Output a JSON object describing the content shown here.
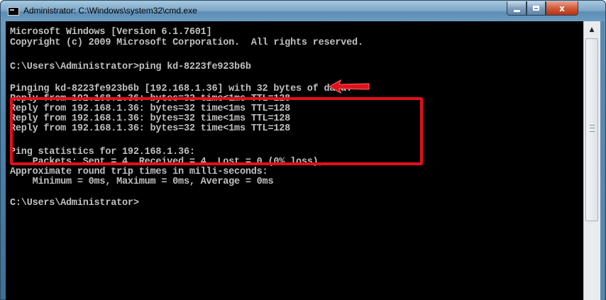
{
  "window": {
    "title": "Administrator: C:\\Windows\\system32\\cmd.exe",
    "icon": "cmd-icon",
    "controls": {
      "minimize": "minimize-icon",
      "maximize": "maximize-icon",
      "close_label": "x"
    }
  },
  "console": {
    "lines": [
      "Microsoft Windows [Version 6.1.7601]",
      "Copyright (c) 2009 Microsoft Corporation.  All rights reserved.",
      "",
      "C:\\Users\\Administrator>ping kd-8223fe923b6b",
      "",
      "Pinging kd-8223fe923b6b [192.168.1.36] with 32 bytes of data:",
      "Reply from 192.168.1.36: bytes=32 time<1ms TTL=128",
      "Reply from 192.168.1.36: bytes=32 time<1ms TTL=128",
      "Reply from 192.168.1.36: bytes=32 time<1ms TTL=128",
      "Reply from 192.168.1.36: bytes=32 time<1ms TTL=128",
      "",
      "Ping statistics for 192.168.1.36:",
      "    Packets: Sent = 4, Received = 4, Lost = 0 (0% loss),",
      "Approximate round trip times in milli-seconds:",
      "    Minimum = 0ms, Maximum = 0ms, Average = 0ms",
      "",
      "C:\\Users\\Administrator>"
    ],
    "text_color": "#c0c0c0",
    "background": "#000000"
  },
  "annotations": {
    "highlight_color": "#e3101a",
    "arrow_icon": "red-arrow-icon"
  },
  "scrollbar": {
    "up_icon": "scroll-up-icon"
  }
}
